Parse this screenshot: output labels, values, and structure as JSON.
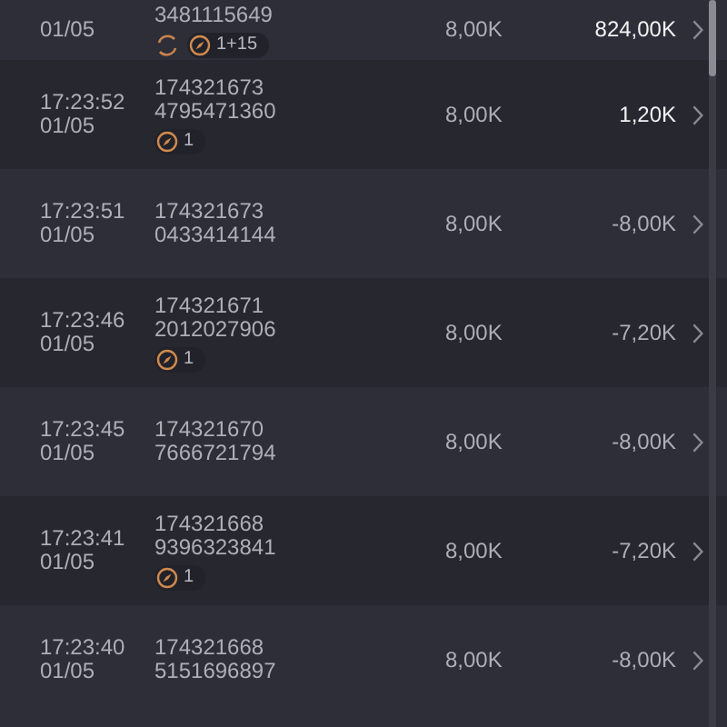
{
  "rows": [
    {
      "date": "01/05",
      "id_lines": [
        "3481115649"
      ],
      "amount": "8,00K",
      "result": "824,00K",
      "emphasis": true,
      "tags": [
        {
          "kind": "refresh"
        },
        {
          "kind": "pill",
          "text": "1+15"
        }
      ]
    },
    {
      "time": "17:23:52",
      "date": "01/05",
      "id_lines": [
        "174321673",
        "4795471360"
      ],
      "amount": "8,00K",
      "result": "1,20K",
      "emphasis": true,
      "tags": [
        {
          "kind": "pill",
          "text": "1"
        }
      ]
    },
    {
      "time": "17:23:51",
      "date": "01/05",
      "id_lines": [
        "174321673",
        "0433414144"
      ],
      "amount": "8,00K",
      "result": "-8,00K",
      "emphasis": false,
      "tags": []
    },
    {
      "time": "17:23:46",
      "date": "01/05",
      "id_lines": [
        "174321671",
        "2012027906"
      ],
      "amount": "8,00K",
      "result": "-7,20K",
      "emphasis": false,
      "tags": [
        {
          "kind": "pill",
          "text": "1"
        }
      ]
    },
    {
      "time": "17:23:45",
      "date": "01/05",
      "id_lines": [
        "174321670",
        "7666721794"
      ],
      "amount": "8,00K",
      "result": "-8,00K",
      "emphasis": false,
      "tags": []
    },
    {
      "time": "17:23:41",
      "date": "01/05",
      "id_lines": [
        "174321668",
        "9396323841"
      ],
      "amount": "8,00K",
      "result": "-7,20K",
      "emphasis": false,
      "tags": [
        {
          "kind": "pill",
          "text": "1"
        }
      ]
    },
    {
      "time": "17:23:40",
      "date": "01/05",
      "id_lines": [
        "174321668",
        "5151696897"
      ],
      "amount": "8,00K",
      "result": "-8,00K",
      "emphasis": false,
      "tags": []
    }
  ]
}
